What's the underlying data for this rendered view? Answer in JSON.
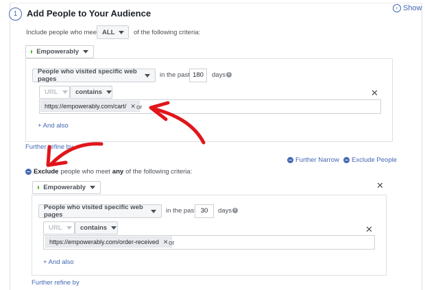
{
  "header": {
    "step_number": "1",
    "title": "Add People to Your Audience",
    "show_label": "Show"
  },
  "include": {
    "prefix": "Include people who meet",
    "match_value": "ALL",
    "suffix": "of the following criteria:",
    "source": "Empowerably",
    "rule": "People who visited specific web pages",
    "in_the_past": "in the past",
    "days_value": "180",
    "days_label": "days",
    "url_field": "URL",
    "operator": "contains",
    "tag": "https://empowerably.com/cart/",
    "or_label": "or",
    "and_also": "+ And also",
    "further_refine": "Further refine by"
  },
  "actions": {
    "further_narrow": "Further Narrow",
    "exclude_people": "Exclude People"
  },
  "exclude": {
    "bold": "Exclude",
    "mid": "people who meet",
    "any": "any",
    "suffix": "of the following criteria:",
    "source": "Empowerably",
    "rule": "People who visited specific web pages",
    "in_the_past": "in the past",
    "days_value": "30",
    "days_label": "days",
    "url_field": "URL",
    "operator": "contains",
    "tag": "https://empowerably.com/order-received",
    "or_label": "or",
    "and_also": "+ And also",
    "further_refine": "Further refine by"
  },
  "colors": {
    "accent": "#4267b2",
    "annotation": "#e0161b",
    "status_green": "#42b72a"
  },
  "icons": [
    "info-icon",
    "close-icon",
    "remove-circle-icon",
    "show-icon",
    "chevron-down-icon"
  ]
}
